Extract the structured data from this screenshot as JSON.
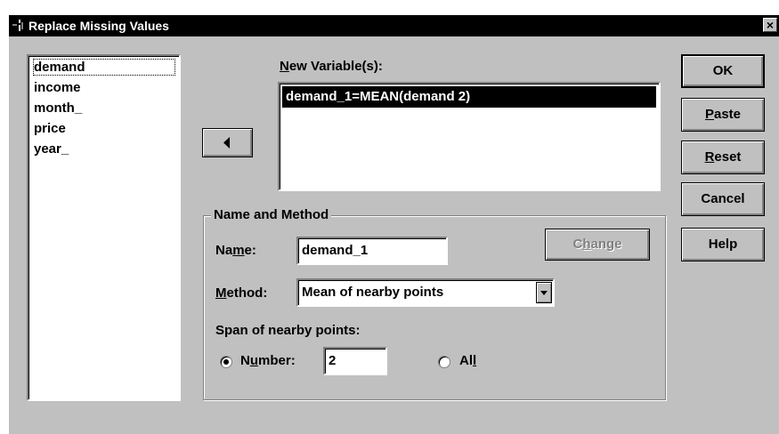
{
  "window": {
    "title": "Replace Missing Values",
    "close_glyph": "×"
  },
  "variables": {
    "items": [
      "demand",
      "income",
      "month_",
      "price",
      "year_"
    ]
  },
  "new_variables": {
    "label": "New Variable(s):",
    "label_mnemonic": "N",
    "label_rest": "ew Variable(s):",
    "items": [
      "demand_1=MEAN(demand 2)"
    ]
  },
  "buttons": {
    "ok": "OK",
    "paste_m": "P",
    "paste_rest": "aste",
    "reset_m": "R",
    "reset_rest": "eset",
    "cancel": "Cancel",
    "help": "Help",
    "change_pre": "C",
    "change_m": "h",
    "change_rest": "ange"
  },
  "name_method": {
    "legend": "Name and Method",
    "name_pre": "Na",
    "name_m": "m",
    "name_rest": "e:",
    "name_value": "demand_1",
    "method_m": "M",
    "method_rest": "ethod:",
    "method_value": "Mean of nearby points",
    "span_label": "Span of nearby points:",
    "number_pre": "N",
    "number_m": "u",
    "number_rest": "mber:",
    "number_value": "2",
    "all_pre": "Al",
    "all_m": "l",
    "span_selected": "number"
  },
  "icons": {
    "arrow": "left-arrow-icon",
    "dropdown": "chevron-down-icon"
  }
}
